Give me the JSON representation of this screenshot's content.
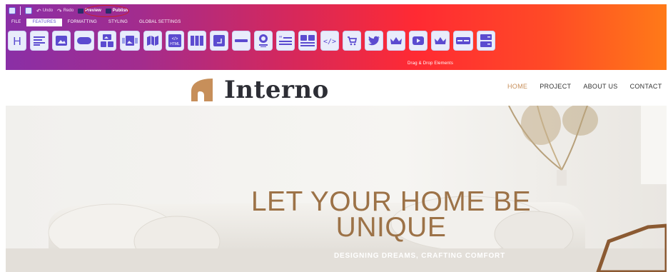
{
  "editor": {
    "topbar": {
      "undo_label": "Undo",
      "redo_label": "Redo",
      "preview_label": "Preview",
      "publish_label": "Publish"
    },
    "tabs": [
      {
        "label": "FILE"
      },
      {
        "label": "FEATURES",
        "active": true
      },
      {
        "label": "FORMATTING"
      },
      {
        "label": "STYLING"
      },
      {
        "label": "GLOBAL SETTINGS"
      }
    ],
    "tools": [
      "heading-icon",
      "paragraph-icon",
      "image-icon",
      "button-icon",
      "gallery-icon",
      "slider-icon",
      "map-icon",
      "html-icon",
      "columns-icon",
      "box-icon",
      "divider-icon",
      "team-member-icon",
      "testimonial-icon",
      "media-text-icon",
      "code-icon",
      "cart-icon",
      "twitter-icon",
      "crown-icon",
      "youtube-icon",
      "crown-icon-2",
      "buttons-row-icon",
      "form-icon"
    ],
    "drag_drop_label": "Drag & Drop Elements",
    "accent_color": "#5b4bd0",
    "tool_bg_color": "#e9ecfb"
  },
  "site": {
    "logo_text": "Interno",
    "logo_color": "#c78f5a",
    "nav": [
      {
        "label": "HOME",
        "active": true
      },
      {
        "label": "PROJECT"
      },
      {
        "label": "ABOUT US"
      },
      {
        "label": "CONTACT"
      }
    ],
    "hero": {
      "title_line1": "LET YOUR HOME BE",
      "title_line2": "UNIQUE",
      "subtitle": "DESIGNING DREAMS, CRAFTING COMFORT",
      "title_color": "#9c7247"
    }
  }
}
